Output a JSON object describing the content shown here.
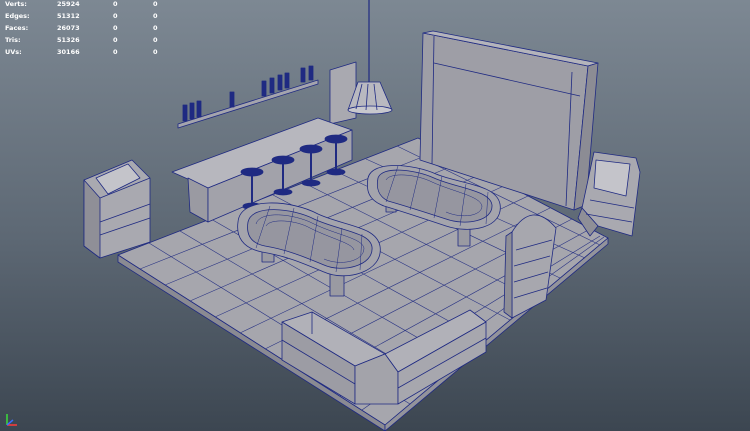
{
  "hud": {
    "rows": [
      {
        "label": "Verts:",
        "v1": "25924",
        "v2": "0",
        "v3": "0"
      },
      {
        "label": "Edges:",
        "v1": "51312",
        "v2": "0",
        "v3": "0"
      },
      {
        "label": "Faces:",
        "v1": "26073",
        "v2": "0",
        "v3": "0"
      },
      {
        "label": "Tris:",
        "v1": "51326",
        "v2": "0",
        "v3": "0"
      },
      {
        "label": "UVs:",
        "v1": "30166",
        "v2": "0",
        "v3": "0"
      }
    ]
  },
  "colors": {
    "background_top": "#7d8893",
    "background_bottom": "#3c4651",
    "mesh_fill": "#a4a4ad",
    "wire": "#1f2a82",
    "hud_text": "#ffffff"
  },
  "icons": {
    "axis_gizmo": "xyz-axis-icon"
  }
}
